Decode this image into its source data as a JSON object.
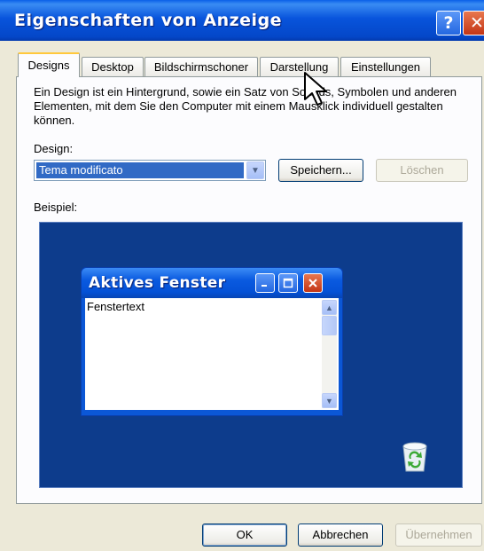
{
  "window": {
    "title": "Eigenschaften von Anzeige",
    "help_glyph": "?",
    "close_glyph": "✕"
  },
  "tabs": [
    {
      "label": "Designs",
      "active": true
    },
    {
      "label": "Desktop",
      "active": false
    },
    {
      "label": "Bildschirmschoner",
      "active": false
    },
    {
      "label": "Darstellung",
      "active": false
    },
    {
      "label": "Einstellungen",
      "active": false
    }
  ],
  "designs_tab": {
    "description": "Ein Design ist ein Hintergrund, sowie ein Satz von Sounds, Symbolen und anderen Elementen, mit dem Sie den Computer mit einem Mausklick individuell gestalten können.",
    "design_label": "Design:",
    "design_value": "Tema modificato",
    "save_button": "Speichern...",
    "delete_button": "Löschen",
    "example_label": "Beispiel:"
  },
  "preview": {
    "window_title": "Aktives Fenster",
    "window_text": "Fenstertext"
  },
  "footer": {
    "ok": "OK",
    "cancel": "Abbrechen",
    "apply": "Übernehmen"
  },
  "colors": {
    "titlebar": "#0854DC",
    "dialog_bg": "#ECE9D8",
    "preview_desktop": "#0D3C8C",
    "selection": "#316AC5"
  }
}
